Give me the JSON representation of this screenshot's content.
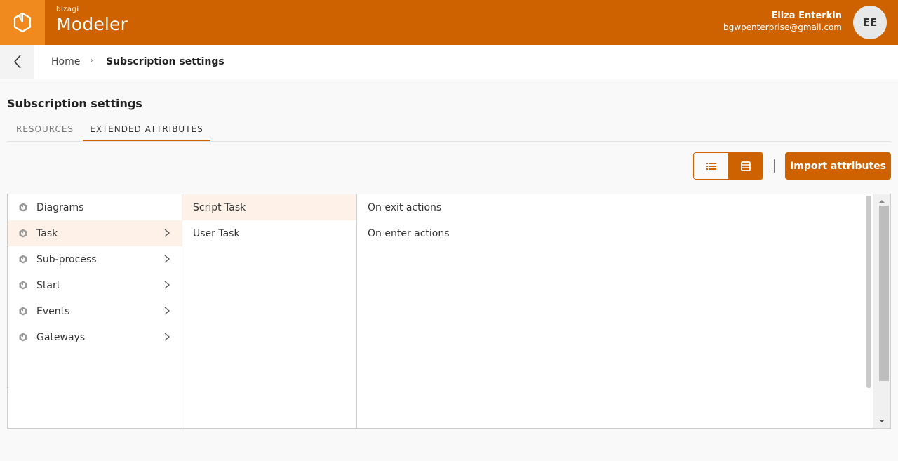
{
  "header": {
    "brand_small": "bizagi",
    "brand_big": "Modeler",
    "user_name": "Eliza Enterkin",
    "user_email": "bgwpenterprise@gmail.com",
    "avatar_initials": "EE",
    "colors": {
      "header_bg": "#cf6200",
      "logo_bg": "#f08a1f"
    }
  },
  "breadcrumb": {
    "items": [
      "Home",
      "Subscription settings"
    ],
    "separator": "›"
  },
  "page": {
    "title": "Subscription settings"
  },
  "tabs": [
    {
      "label": "RESOURCES",
      "active": false
    },
    {
      "label": "EXTENDED ATTRIBUTES",
      "active": true
    }
  ],
  "toolbar": {
    "view_list_icon": "list-icon",
    "view_detail_icon": "detail-view-icon",
    "active_view": "detail",
    "import_label": "Import attributes"
  },
  "columns": {
    "categories": [
      {
        "label": "Diagrams",
        "icon": "hexagon-icon",
        "has_children": false,
        "selected": false
      },
      {
        "label": "Task",
        "icon": "hexagon-icon",
        "has_children": true,
        "selected": true
      },
      {
        "label": "Sub-process",
        "icon": "hexagon-icon",
        "has_children": true,
        "selected": false
      },
      {
        "label": "Start",
        "icon": "hexagon-icon",
        "has_children": true,
        "selected": false
      },
      {
        "label": "Events",
        "icon": "hexagon-icon",
        "has_children": true,
        "selected": false
      },
      {
        "label": "Gateways",
        "icon": "hexagon-icon",
        "has_children": true,
        "selected": false
      }
    ],
    "subtypes": [
      {
        "label": "Script Task",
        "selected": true
      },
      {
        "label": "User Task",
        "selected": false
      }
    ],
    "attributes": [
      {
        "label": "On exit actions"
      },
      {
        "label": "On enter actions"
      }
    ]
  }
}
